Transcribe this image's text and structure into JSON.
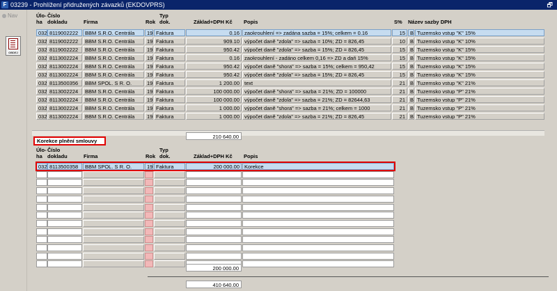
{
  "window": {
    "title": "03239 - Prohlížení přidružených závazků (EKDOVPRS)",
    "app_icon": "app-icon",
    "restore_symbol": "🗗"
  },
  "left_pane": {
    "nav_label": "Nav",
    "report_button_label": "OBDEJ"
  },
  "upper_table": {
    "headers": {
      "uloha_top": "Úlo-",
      "uloha_bottom": "ha",
      "cislo_top": "Číslo",
      "cislo_bottom": "dokladu",
      "firma": "Firma",
      "rok": "Rok",
      "typ_top": "Typ",
      "typ_bottom": "dok.",
      "zaklad": "Základ+DPH Kč",
      "popis": "Popis",
      "s": "S%",
      "nazev": "Název sazby DPH"
    },
    "rows": [
      {
        "uloha": "032",
        "cislo": "8119002222",
        "firma": "BBM S.R.O.  Centrála",
        "rok": "19",
        "typ": "Faktura",
        "zaklad": "0.16",
        "popis": "zaokrouhlení => zadána sazba =  15%; celkem = 0.16",
        "s": "15",
        "sazba_kod": "B",
        "nazev": "Tuzemsko vstup \"K\" 15%"
      },
      {
        "uloha": "032",
        "cislo": "8119002222",
        "firma": "BBM S.R.O.  Centrála",
        "rok": "19",
        "typ": "Faktura",
        "zaklad": "909.10",
        "popis": "výpočet daně \"zdola\" => sazba = 10%; ZD = 826,45",
        "s": "10",
        "sazba_kod": "B",
        "nazev": "Tuzemsko vstup \"K\" 10%"
      },
      {
        "uloha": "032",
        "cislo": "8119002222",
        "firma": "BBM S.R.O.  Centrála",
        "rok": "19",
        "typ": "Faktura",
        "zaklad": "950.42",
        "popis": "výpočet daně \"zdola\" => sazba = 15%; ZD = 826,45",
        "s": "15",
        "sazba_kod": "B",
        "nazev": "Tuzemsko vstup \"K\" 15%"
      },
      {
        "uloha": "032",
        "cislo": "8113002224",
        "firma": "BBM S.R.O.  Centrála",
        "rok": "19",
        "typ": "Faktura",
        "zaklad": "0.16",
        "popis": "zaokrouhlení - zadáno celkem 0,16 => ZD a daň 15%",
        "s": "15",
        "sazba_kod": "B",
        "nazev": "Tuzemsko vstup \"K\" 15%"
      },
      {
        "uloha": "032",
        "cislo": "8113002224",
        "firma": "BBM S.R.O.  Centrála",
        "rok": "19",
        "typ": "Faktura",
        "zaklad": "950.42",
        "popis": "výpočet daně \"shora\" => sazba = 15%; celkem = 950,42",
        "s": "15",
        "sazba_kod": "B",
        "nazev": "Tuzemsko vstup \"K\" 15%"
      },
      {
        "uloha": "032",
        "cislo": "8113002224",
        "firma": "BBM S.R.O.  Centrála",
        "rok": "19",
        "typ": "Faktura",
        "zaklad": "950.42",
        "popis": "výpočet daně \"zdola\" => sazba = 15%; ZD = 826,45",
        "s": "15",
        "sazba_kod": "B",
        "nazev": "Tuzemsko vstup \"K\" 15%"
      },
      {
        "uloha": "032",
        "cislo": "8113500356",
        "firma": "BBM SPOL. S R. O.",
        "rok": "19",
        "typ": "Faktura",
        "zaklad": "1 200.00",
        "popis": "text",
        "s": "21",
        "sazba_kod": "B",
        "nazev": "Tuzemsko vstup \"K\" 21%"
      },
      {
        "uloha": "032",
        "cislo": "8113002224",
        "firma": "BBM S.R.O.  Centrála",
        "rok": "19",
        "typ": "Faktura",
        "zaklad": "100 000.00",
        "popis": "výpočet daně \"shora\" => sazba = 21%; ZD = 100000",
        "s": "21",
        "sazba_kod": "B",
        "nazev": "Tuzemsko vstup \"P\" 21%"
      },
      {
        "uloha": "032",
        "cislo": "8113002224",
        "firma": "BBM S.R.O.  Centrála",
        "rok": "19",
        "typ": "Faktura",
        "zaklad": "100 000.00",
        "popis": "výpočet daně \"zdola\" => sazba = 21%; ZD = 82644,63",
        "s": "21",
        "sazba_kod": "B",
        "nazev": "Tuzemsko vstup \"P\" 21%"
      },
      {
        "uloha": "032",
        "cislo": "8113002224",
        "firma": "BBM S.R.O.  Centrála",
        "rok": "19",
        "typ": "Faktura",
        "zaklad": "1 000.00",
        "popis": "výpočet daně \"shora\" => sazba = 21%; celkem = 1000",
        "s": "21",
        "sazba_kod": "B",
        "nazev": "Tuzemsko vstup \"P\" 21%"
      },
      {
        "uloha": "032",
        "cislo": "8113002224",
        "firma": "BBM S.R.O.  Centrála",
        "rok": "19",
        "typ": "Faktura",
        "zaklad": "1 000.00",
        "popis": "výpočet daně \"zdola\" => sazba = 21%; ZD = 826,45",
        "s": "21",
        "sazba_kod": "B",
        "nazev": "Tuzemsko vstup \"P\" 21%"
      }
    ],
    "total": "210 640.00"
  },
  "lower_section": {
    "title": "Korekce plnění smlouvy",
    "headers": {
      "uloha_top": "Úlo-",
      "uloha_bottom": "ha",
      "cislo_top": "Číslo",
      "cislo_bottom": "dokladu",
      "firma": "Firma",
      "rok": "Rok",
      "typ_top": "Typ",
      "typ_bottom": "dok.",
      "zaklad": "Základ+DPH Kč",
      "popis": "Popis"
    },
    "rows": [
      {
        "uloha": "032",
        "cislo": "8113500358",
        "firma": "BBM SPOL. S R. O.",
        "rok": "19",
        "typ": "Faktura",
        "zaklad": "200 000.00",
        "popis": "Korekce"
      }
    ],
    "empty_rows": 12,
    "total": "200 000.00"
  },
  "grand_total": "410 640.00",
  "colors": {
    "titlebar": "#0a246a",
    "selected_row": "#c6dcf0",
    "highlight_red": "#e00000",
    "year_pink": "#f2b8b8",
    "panel": "#d4d0c8"
  }
}
